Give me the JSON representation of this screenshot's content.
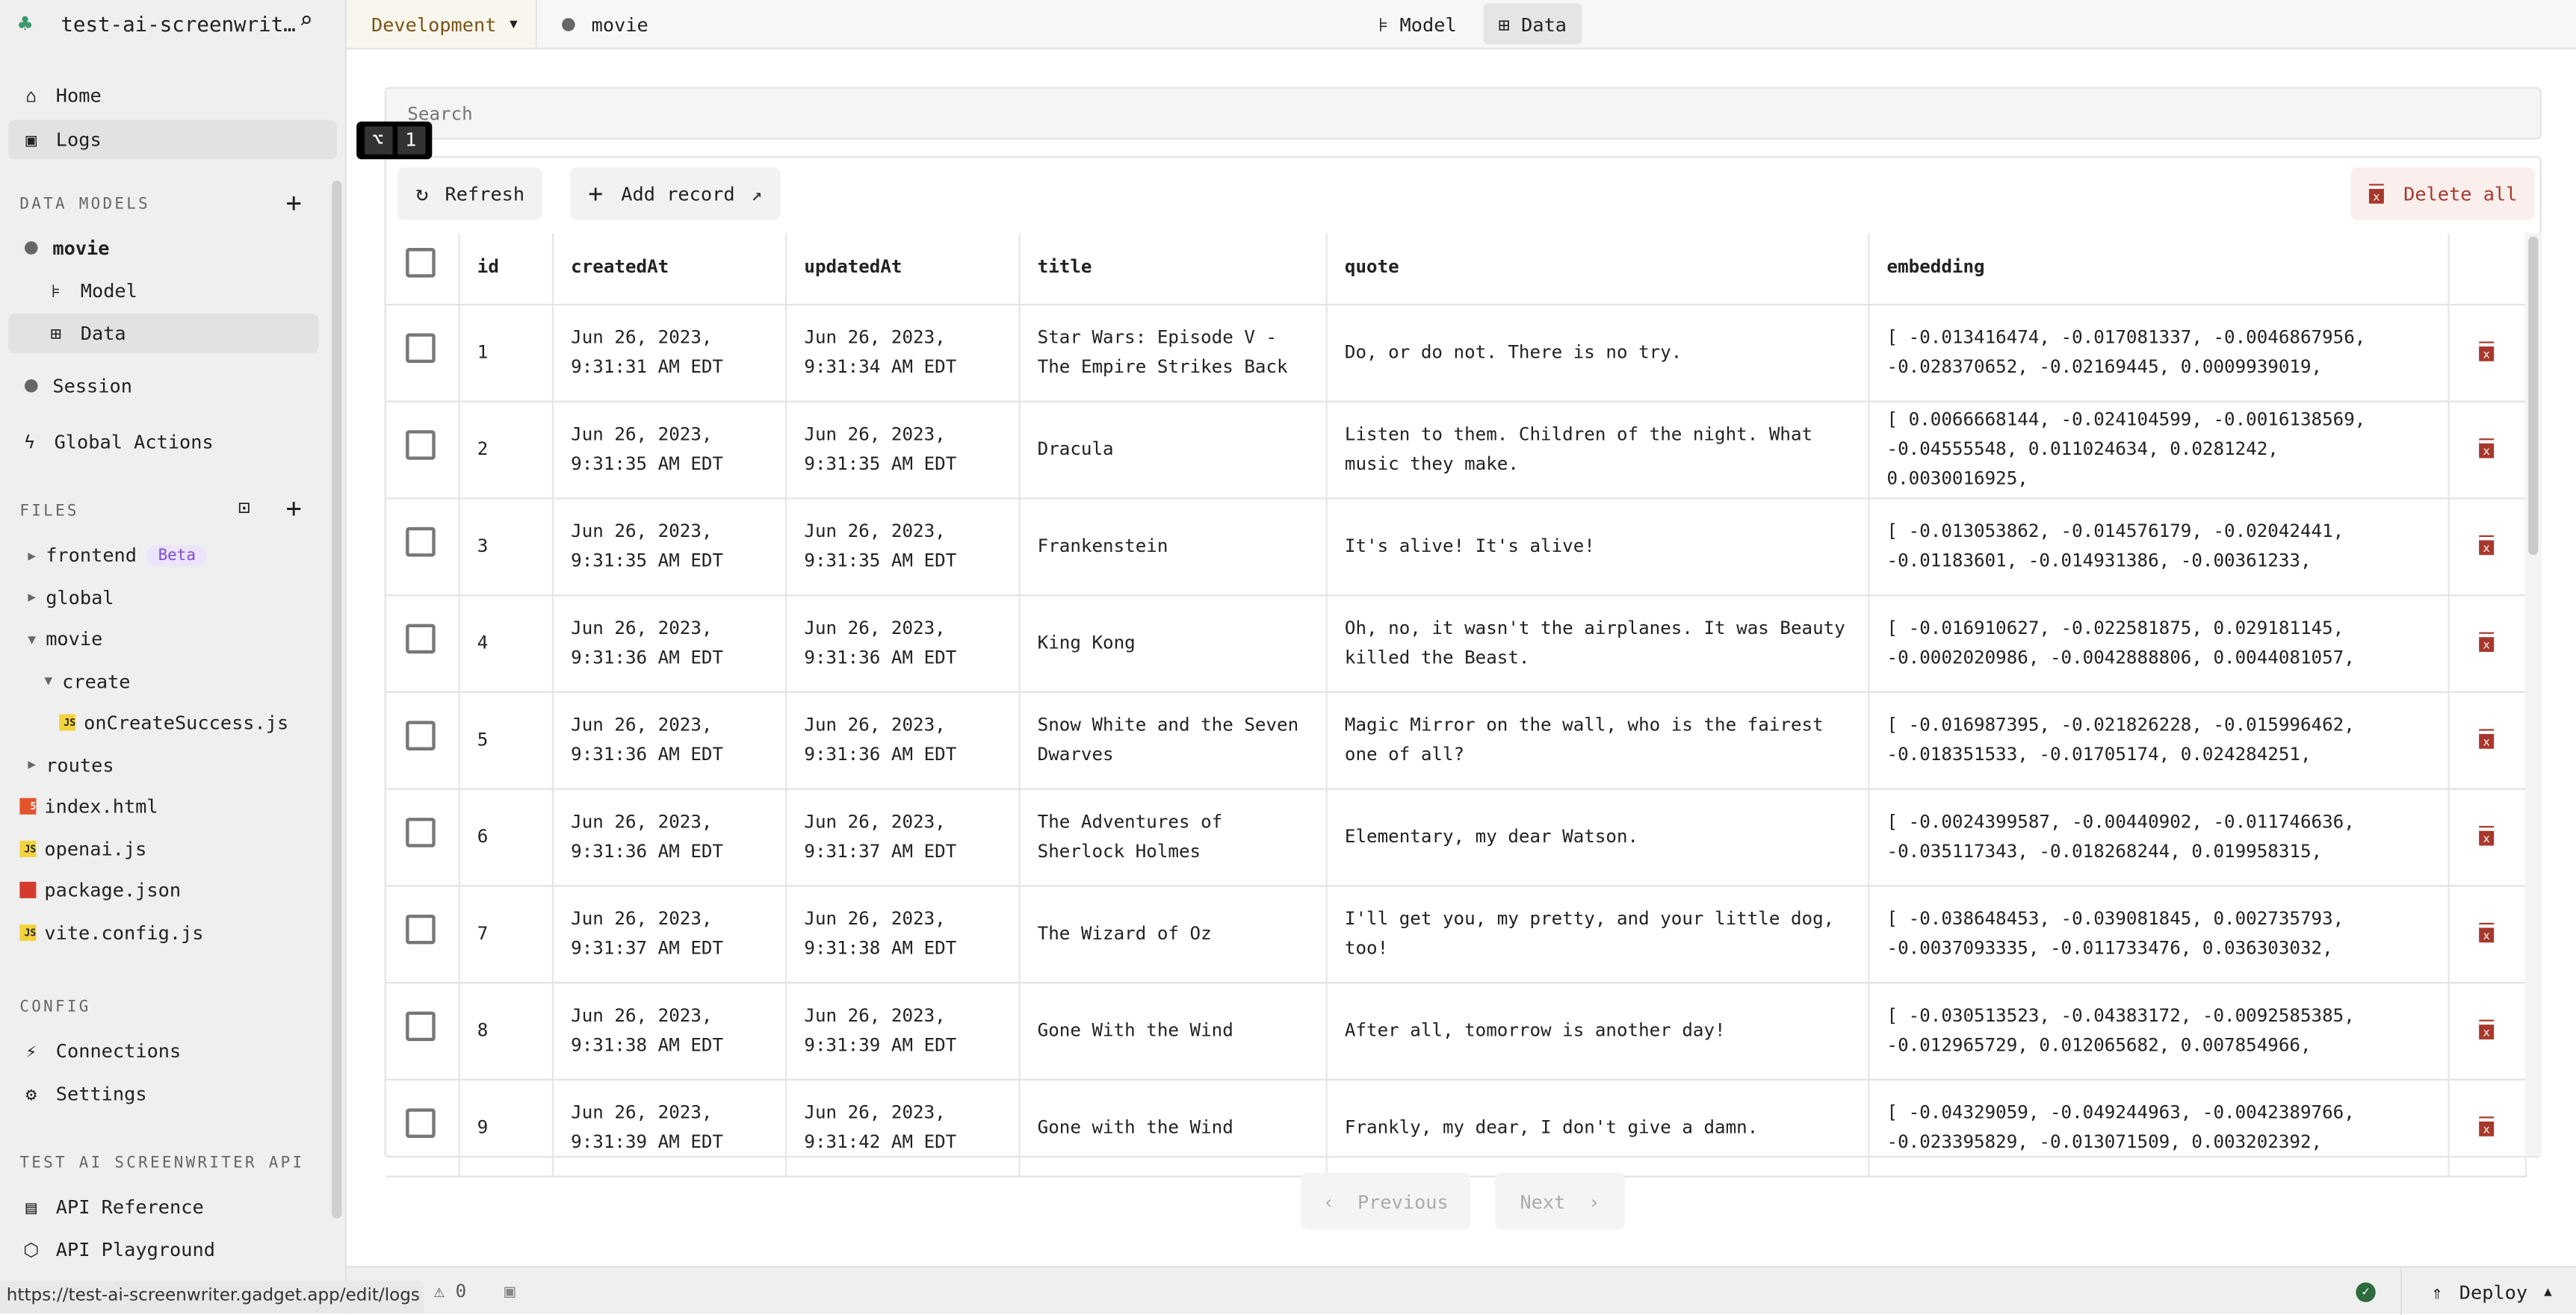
{
  "app": {
    "title": "test-ai-screenwrit…",
    "environment": "Development",
    "model_name": "movie"
  },
  "tabs": [
    {
      "label": "Model"
    },
    {
      "label": "Data",
      "active": true
    }
  ],
  "sidebar": {
    "top": [
      {
        "label": "Home",
        "icon": "home-icon"
      },
      {
        "label": "Logs",
        "icon": "terminal-icon",
        "selected": true
      }
    ],
    "data_models_heading": "DATA MODELS",
    "models": [
      {
        "label": "movie"
      },
      {
        "label": "Model"
      },
      {
        "label": "Data"
      },
      {
        "label": "Session"
      }
    ],
    "global_actions": "Global Actions",
    "files_heading": "FILES",
    "files": [
      {
        "label": "frontend",
        "badge": "Beta"
      },
      {
        "label": "global"
      },
      {
        "label": "movie"
      },
      {
        "label": "create"
      },
      {
        "label": "onCreateSuccess.js"
      },
      {
        "label": "routes"
      },
      {
        "label": "index.html"
      },
      {
        "label": "openai.js"
      },
      {
        "label": "package.json"
      },
      {
        "label": "vite.config.js"
      }
    ],
    "config_heading": "CONFIG",
    "config": [
      {
        "label": "Connections"
      },
      {
        "label": "Settings"
      }
    ],
    "api_heading": "TEST AI SCREENWRITER API",
    "api": [
      {
        "label": "API Reference"
      },
      {
        "label": "API Playground"
      }
    ]
  },
  "shortcut": {
    "key1": "⌥",
    "key2": "1"
  },
  "search": {
    "placeholder": "Search"
  },
  "toolbar": {
    "refresh": "Refresh",
    "add_record": "Add record",
    "delete_all": "Delete all"
  },
  "table": {
    "columns": [
      "id",
      "createdAt",
      "updatedAt",
      "title",
      "quote",
      "embedding"
    ],
    "rows": [
      {
        "id": "1",
        "createdAt": [
          "Jun 26, 2023,",
          "9:31:31 AM EDT"
        ],
        "updatedAt": [
          "Jun 26, 2023,",
          "9:31:34 AM EDT"
        ],
        "title": "Star Wars: Episode V - The Empire Strikes Back",
        "quote": "Do, or do not. There is no try.",
        "embedding": "[ -0.013416474, -0.017081337, -0.0046867956, -0.028370652, -0.02169445, 0.0009939019,"
      },
      {
        "id": "2",
        "createdAt": [
          "Jun 26, 2023,",
          "9:31:35 AM EDT"
        ],
        "updatedAt": [
          "Jun 26, 2023,",
          "9:31:35 AM EDT"
        ],
        "title": "Dracula",
        "quote": "Listen to them. Children of the night. What music they make.",
        "embedding": "[ 0.0066668144, -0.024104599, -0.0016138569, -0.04555548, 0.011024634, 0.0281242, 0.0030016925,"
      },
      {
        "id": "3",
        "createdAt": [
          "Jun 26, 2023,",
          "9:31:35 AM EDT"
        ],
        "updatedAt": [
          "Jun 26, 2023,",
          "9:31:35 AM EDT"
        ],
        "title": "Frankenstein",
        "quote": "It's alive! It's alive!",
        "embedding": "[ -0.013053862, -0.014576179, -0.02042441, -0.01183601, -0.014931386, -0.00361233,"
      },
      {
        "id": "4",
        "createdAt": [
          "Jun 26, 2023,",
          "9:31:36 AM EDT"
        ],
        "updatedAt": [
          "Jun 26, 2023,",
          "9:31:36 AM EDT"
        ],
        "title": "King Kong",
        "quote": "Oh, no, it wasn't the airplanes. It was Beauty killed the Beast.",
        "embedding": "[ -0.016910627, -0.022581875, 0.029181145, -0.0002020986, -0.0042888806, 0.0044081057,"
      },
      {
        "id": "5",
        "createdAt": [
          "Jun 26, 2023,",
          "9:31:36 AM EDT"
        ],
        "updatedAt": [
          "Jun 26, 2023,",
          "9:31:36 AM EDT"
        ],
        "title": "Snow White and the Seven Dwarves",
        "quote": "Magic Mirror on the wall, who is the fairest one of all?",
        "embedding": "[ -0.016987395, -0.021826228, -0.015996462, -0.018351533, -0.01705174, 0.024284251,"
      },
      {
        "id": "6",
        "createdAt": [
          "Jun 26, 2023,",
          "9:31:36 AM EDT"
        ],
        "updatedAt": [
          "Jun 26, 2023,",
          "9:31:37 AM EDT"
        ],
        "title": "The Adventures of Sherlock Holmes",
        "quote": "Elementary, my dear Watson.",
        "embedding": "[ -0.0024399587, -0.00440902, -0.011746636, -0.035117343, -0.018268244, 0.019958315,"
      },
      {
        "id": "7",
        "createdAt": [
          "Jun 26, 2023,",
          "9:31:37 AM EDT"
        ],
        "updatedAt": [
          "Jun 26, 2023,",
          "9:31:38 AM EDT"
        ],
        "title": "The Wizard of Oz",
        "quote": "I'll get you, my pretty, and your little dog, too!",
        "embedding": "[ -0.038648453, -0.039081845, 0.002735793, -0.0037093335, -0.011733476, 0.036303032,"
      },
      {
        "id": "8",
        "createdAt": [
          "Jun 26, 2023,",
          "9:31:38 AM EDT"
        ],
        "updatedAt": [
          "Jun 26, 2023,",
          "9:31:39 AM EDT"
        ],
        "title": "Gone With the Wind",
        "quote": "After all, tomorrow is another day!",
        "embedding": "[ -0.030513523, -0.04383172, -0.0092585385, -0.012965729, 0.012065682, 0.007854966,"
      },
      {
        "id": "9",
        "createdAt": [
          "Jun 26, 2023,",
          "9:31:39 AM EDT"
        ],
        "updatedAt": [
          "Jun 26, 2023,",
          "9:31:42 AM EDT"
        ],
        "title": "Gone with the Wind",
        "quote": "Frankly, my dear, I don't give a damn.",
        "embedding": "[ -0.04329059, -0.049244963, -0.0042389766, -0.023395829, -0.013071509, 0.003202392,"
      }
    ]
  },
  "pagination": {
    "previous": "Previous",
    "next": "Next"
  },
  "statusbar": {
    "warnings": "0",
    "deploy": "Deploy",
    "url": "https://test-ai-screenwriter.gadget.app/edit/logs"
  },
  "colors": {
    "danger": "#a8382c",
    "env_bg": "#f9f6ee",
    "env_text": "#7a5417",
    "beta_bg": "#ece4fb",
    "ok": "#2e6b3d"
  }
}
